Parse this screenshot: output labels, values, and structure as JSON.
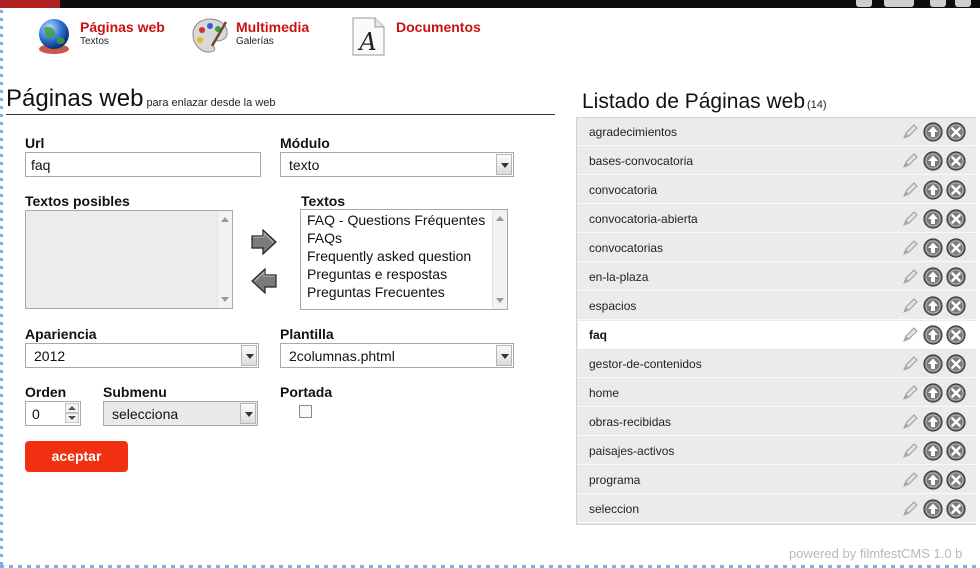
{
  "nav": [
    {
      "title": "Páginas web",
      "subtitle": "Textos",
      "icon": "globe-icon"
    },
    {
      "title": "Multimedia",
      "subtitle": "Galerías",
      "icon": "palette-icon"
    },
    {
      "title": "Documentos",
      "subtitle": "",
      "icon": "document-icon"
    }
  ],
  "form": {
    "title": "Páginas web",
    "subtitle": "para enlazar desde la web",
    "url_label": "Url",
    "url_value": "faq",
    "modulo_label": "Módulo",
    "modulo_value": "texto",
    "textos_posibles_label": "Textos posibles",
    "textos_posibles": [],
    "textos_label": "Textos",
    "textos": [
      "FAQ - Questions Fréquentes",
      "FAQs",
      "Frequently asked question",
      "Preguntas e respostas",
      "Preguntas Frecuentes"
    ],
    "apariencia_label": "Apariencia",
    "apariencia_value": "2012",
    "plantilla_label": "Plantilla",
    "plantilla_value": "2columnas.phtml",
    "orden_label": "Orden",
    "orden_value": "0",
    "submenu_label": "Submenu",
    "submenu_value": "selecciona",
    "portada_label": "Portada",
    "portada_checked": false,
    "accept_label": "aceptar"
  },
  "listing": {
    "title": "Listado de Páginas web",
    "count": "(14)",
    "selected": "faq",
    "pages": [
      "agradecimientos",
      "bases-convocatoria",
      "convocatoria",
      "convocatoria-abierta",
      "convocatorias",
      "en-la-plaza",
      "espacios",
      "faq",
      "gestor-de-contenidos",
      "home",
      "obras-recibidas",
      "paisajes-activos",
      "programa",
      "seleccion"
    ]
  },
  "footer": {
    "powered": "powered by filmfestCMS 1.0 b"
  },
  "colors": {
    "accent_red": "#cc1111",
    "button_red": "#f03010",
    "list_bg": "#ebebeb"
  }
}
